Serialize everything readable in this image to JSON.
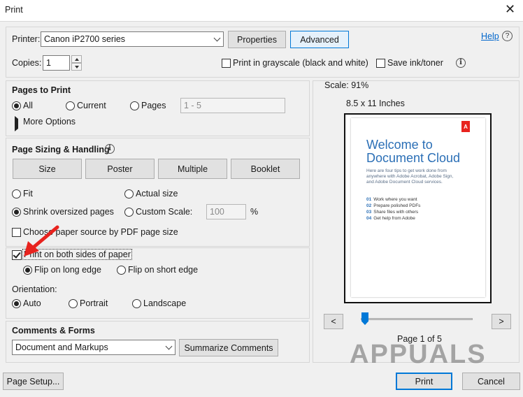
{
  "window": {
    "title": "Print",
    "close_glyph": "✕"
  },
  "printer": {
    "label": "Printer:",
    "selected": "Canon iP2700 series",
    "properties_label": "Properties",
    "advanced_label": "Advanced",
    "help_label": "Help"
  },
  "copies": {
    "label": "Copies:",
    "value": "1"
  },
  "options": {
    "grayscale_label": "Print in grayscale (black and white)",
    "save_ink_label": "Save ink/toner"
  },
  "pages_to_print": {
    "title": "Pages to Print",
    "all_label": "All",
    "current_label": "Current",
    "pages_label": "Pages",
    "pages_value": "1 - 5",
    "more_options_label": "More Options"
  },
  "sizing": {
    "title": "Page Sizing & Handling",
    "tabs": [
      "Size",
      "Poster",
      "Multiple",
      "Booklet"
    ],
    "fit_label": "Fit",
    "actual_size_label": "Actual size",
    "shrink_label": "Shrink oversized pages",
    "custom_scale_label": "Custom Scale:",
    "custom_scale_value": "100",
    "percent": "%",
    "paper_source_label": "Choose paper source by PDF page size"
  },
  "duplex": {
    "both_sides_label": "Print on both sides of paper",
    "long_edge_label": "Flip on long edge",
    "short_edge_label": "Flip on short edge"
  },
  "orientation": {
    "title": "Orientation:",
    "auto_label": "Auto",
    "portrait_label": "Portrait",
    "landscape_label": "Landscape"
  },
  "comments": {
    "title": "Comments & Forms",
    "selected": "Document and Markups",
    "summarize_label": "Summarize Comments"
  },
  "preview": {
    "scale_label": "Scale:  91%",
    "paper_size": "8.5 x 11 Inches",
    "doc_title_1": "Welcome to",
    "doc_title_2": "Document Cloud",
    "doc_body_1": "Here are four tips to get work done from",
    "doc_body_2": "anywhere with Adobe Acrobat, Adobe Sign,",
    "doc_body_3": "and Adobe Document Cloud services.",
    "doc_items": [
      {
        "num": "01",
        "text": "Work where you want"
      },
      {
        "num": "02",
        "text": "Prepare polished PDFs"
      },
      {
        "num": "03",
        "text": "Share files with others"
      },
      {
        "num": "04",
        "text": "Get help from Adobe"
      }
    ],
    "prev_label": "<",
    "next_label": ">",
    "page_indicator": "Page 1 of 5"
  },
  "footer": {
    "page_setup_label": "Page Setup...",
    "print_label": "Print",
    "cancel_label": "Cancel"
  },
  "watermark": "APPUALS",
  "colors": {
    "accent": "#0078d7",
    "arrow": "#e8231e",
    "link": "#0066cc"
  }
}
